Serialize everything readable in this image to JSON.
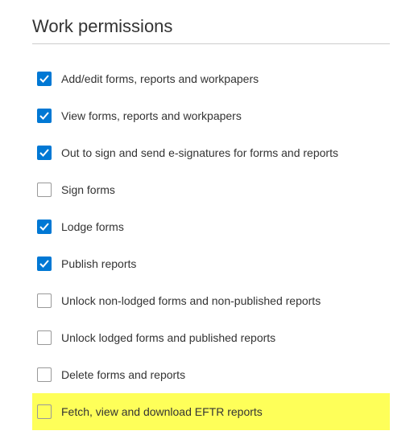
{
  "section": {
    "title": "Work permissions"
  },
  "permissions": [
    {
      "label": "Add/edit forms, reports and workpapers",
      "checked": true,
      "highlighted": false
    },
    {
      "label": "View forms, reports and workpapers",
      "checked": true,
      "highlighted": false
    },
    {
      "label": "Out to sign and send e-signatures for forms and reports",
      "checked": true,
      "highlighted": false
    },
    {
      "label": "Sign forms",
      "checked": false,
      "highlighted": false
    },
    {
      "label": "Lodge forms",
      "checked": true,
      "highlighted": false
    },
    {
      "label": "Publish reports",
      "checked": true,
      "highlighted": false
    },
    {
      "label": "Unlock non-lodged forms and non-published reports",
      "checked": false,
      "highlighted": false
    },
    {
      "label": "Unlock lodged forms and published reports",
      "checked": false,
      "highlighted": false
    },
    {
      "label": "Delete forms and reports",
      "checked": false,
      "highlighted": false
    },
    {
      "label": "Fetch, view and download EFTR reports",
      "checked": false,
      "highlighted": true
    }
  ]
}
